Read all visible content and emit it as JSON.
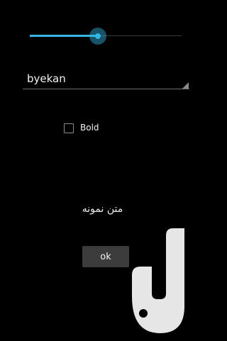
{
  "slider": {
    "value_percent": 45
  },
  "font_spinner": {
    "selected": "byekan"
  },
  "bold_checkbox": {
    "label": "Bold",
    "checked": false
  },
  "preview": {
    "sample_text": "متن نمونه"
  },
  "ok_button": {
    "label": "ok"
  },
  "watermark": {
    "icon": "app-logo-icon"
  },
  "colors": {
    "accent": "#33b5e5",
    "background": "#000000",
    "button": "#3c3c3c"
  }
}
